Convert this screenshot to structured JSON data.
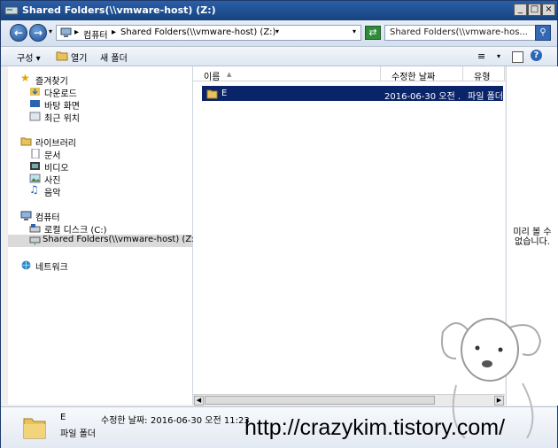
{
  "window": {
    "title": "Shared Folders(\\\\vmware-host) (Z:)"
  },
  "address": {
    "segments": [
      "컴퓨터",
      "Shared Folders(\\\\vmware-host) (Z:)"
    ],
    "search_placeholder": "Shared Folders(\\\\vmware-hos..."
  },
  "toolbar": {
    "organize": "구성",
    "open": "열기",
    "new_folder": "새 폴더"
  },
  "nav": {
    "favorites": {
      "label": "즐겨찾기",
      "items": [
        "다운로드",
        "바탕 화면",
        "최근 위치"
      ]
    },
    "libraries": {
      "label": "라이브러리",
      "items": [
        "문서",
        "비디오",
        "사진",
        "음악"
      ]
    },
    "computer": {
      "label": "컴퓨터",
      "items": [
        "로컬 디스크 (C:)",
        "Shared Folders(\\\\vmware-host) (Z:)"
      ]
    },
    "network": {
      "label": "네트워크"
    }
  },
  "list": {
    "columns": [
      "이름",
      "수정한 날짜",
      "유형"
    ],
    "rows": [
      {
        "name": "E",
        "modified": "2016-06-30 오전 ...",
        "type": "파일 폴더"
      }
    ]
  },
  "preview": {
    "text": "미리 볼 수 없습니다."
  },
  "details": {
    "name": "E",
    "modified_label": "수정한 날짜:",
    "modified_value": "2016-06-30 오전 11:23",
    "type": "파일 폴더"
  },
  "watermark": "http://crazykim.tistory.com/",
  "colors": {
    "titlebar": "#1f4f93",
    "selection": "#0a246a",
    "folder": "#e8c25a"
  }
}
